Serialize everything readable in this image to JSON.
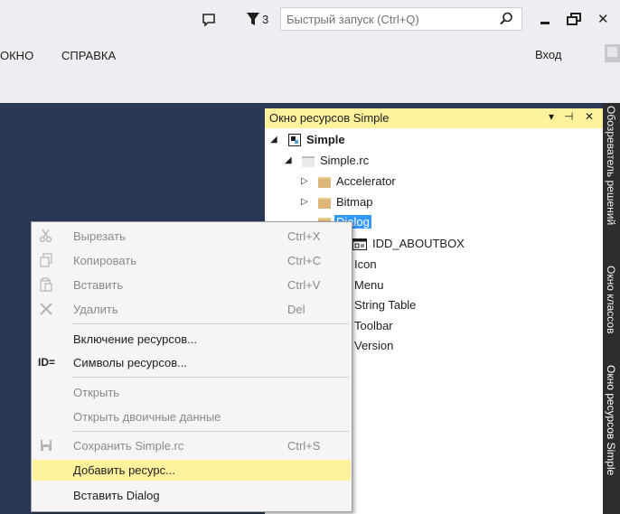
{
  "titlebar": {
    "notification_count": "3",
    "quick_launch_placeholder": "Быстрый запуск (Ctrl+Q)",
    "close_glyph": "✕"
  },
  "menubar": {
    "items": [
      {
        "label": "ОКНО"
      },
      {
        "label": "СПРАВКА"
      }
    ],
    "login_label": "Вход"
  },
  "resource_view": {
    "title": "Окно ресурсов Simple",
    "controls": {
      "dropdown": "▾",
      "pin": "⊣",
      "close": "✕"
    },
    "tree": [
      {
        "label": "Simple",
        "expanded": true,
        "bold": true,
        "icon": "project-icon"
      },
      {
        "label": "Simple.rc",
        "expanded": true,
        "icon": "rc-file-icon"
      },
      {
        "label": "Accelerator",
        "expanded": false,
        "icon": "folder-icon"
      },
      {
        "label": "Bitmap",
        "expanded": false,
        "icon": "folder-icon"
      },
      {
        "label": "Dialog",
        "expanded": true,
        "selected": true,
        "icon": "folder-icon"
      },
      {
        "label": "IDD_ABOUTBOX",
        "icon": "dialog-resource-icon"
      },
      {
        "label": "Icon",
        "icon": "folder-icon"
      },
      {
        "label": "Menu",
        "icon": "folder-icon"
      },
      {
        "label": "String Table",
        "icon": "folder-icon"
      },
      {
        "label": "Toolbar",
        "icon": "folder-icon"
      },
      {
        "label": "Version",
        "icon": "folder-icon"
      }
    ]
  },
  "side_tabs": [
    {
      "label": "Обозреватель решений"
    },
    {
      "label": "Окно классов"
    },
    {
      "label": "Окно ресурсов Simple"
    }
  ],
  "context_menu": {
    "items": [
      {
        "label": "Вырезать",
        "shortcut": "Ctrl+X",
        "enabled": false,
        "icon": "cut-icon"
      },
      {
        "label": "Копировать",
        "shortcut": "Ctrl+C",
        "enabled": false,
        "icon": "copy-icon"
      },
      {
        "label": "Вставить",
        "shortcut": "Ctrl+V",
        "enabled": false,
        "icon": "paste-icon"
      },
      {
        "label": "Удалить",
        "shortcut": "Del",
        "enabled": false,
        "icon": "delete-icon"
      },
      {
        "label": "Включение ресурсов...",
        "shortcut": "",
        "enabled": true
      },
      {
        "label": "Символы ресурсов...",
        "shortcut": "",
        "enabled": true,
        "icon": "id-icon",
        "icon_text": "ID="
      },
      {
        "label": "Открыть",
        "shortcut": "",
        "enabled": false
      },
      {
        "label": "Открыть двоичные данные",
        "shortcut": "",
        "enabled": false
      },
      {
        "label": "Сохранить Simple.rc",
        "shortcut": "Ctrl+S",
        "enabled": false,
        "icon": "save-icon"
      },
      {
        "label": "Добавить ресурс...",
        "shortcut": "",
        "enabled": true,
        "highlighted": true
      },
      {
        "label": "Вставить Dialog",
        "shortcut": "",
        "enabled": true
      }
    ]
  },
  "colors": {
    "accent_highlight": "#fff29d",
    "editor_background": "#293955",
    "selection": "#3399ff",
    "chrome_background": "#eeeef2"
  }
}
